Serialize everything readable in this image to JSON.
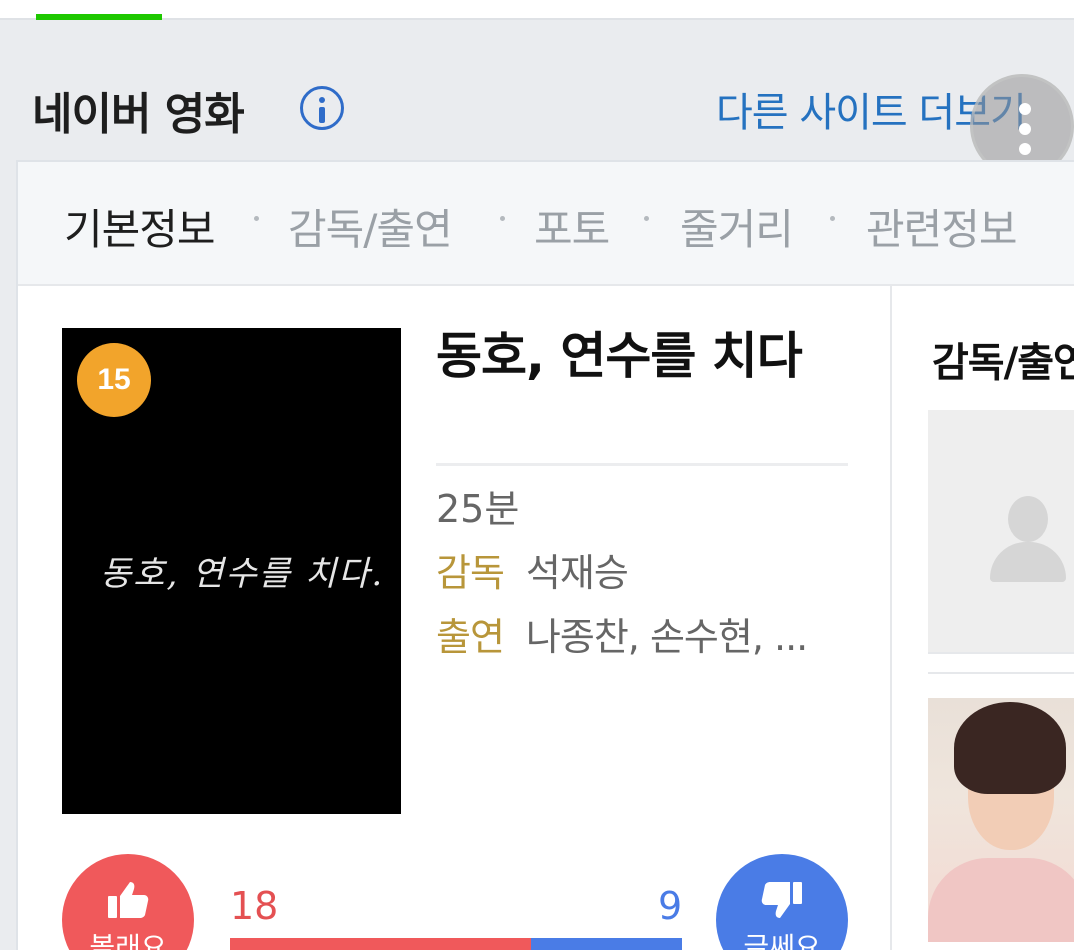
{
  "header": {
    "title": "네이버 영화",
    "more_sites": "다른 사이트 더보기"
  },
  "tabs": [
    {
      "label": "기본정보",
      "active": true
    },
    {
      "label": "감독/출연",
      "active": false
    },
    {
      "label": "포토",
      "active": false
    },
    {
      "label": "줄거리",
      "active": false
    },
    {
      "label": "관련정보",
      "active": false
    }
  ],
  "movie": {
    "age_rating": "15",
    "poster_title": "동호, 연수를 치다.",
    "title": "동호, 연수를 치다",
    "runtime": "25분",
    "director_label": "감독",
    "director": "석재승",
    "cast_label": "출연",
    "cast": "나종찬, 손수현, ..."
  },
  "votes": {
    "like_label": "볼래요",
    "like_count": "18",
    "dislike_label": "글쎄요",
    "dislike_count": "9",
    "like_fraction": 0.667
  },
  "right_column": {
    "heading": "감독/출연"
  },
  "colors": {
    "naver_green": "#1ec800",
    "link_blue": "#2572c0",
    "label_gold": "#b8963a",
    "like_red": "#f0595b",
    "dislike_blue": "#4a7ce6",
    "age_badge": "#f2a42b"
  },
  "icons": [
    "info-icon",
    "kebab-menu-icon",
    "thumbs-up-icon",
    "thumbs-down-icon",
    "person-placeholder-icon"
  ]
}
